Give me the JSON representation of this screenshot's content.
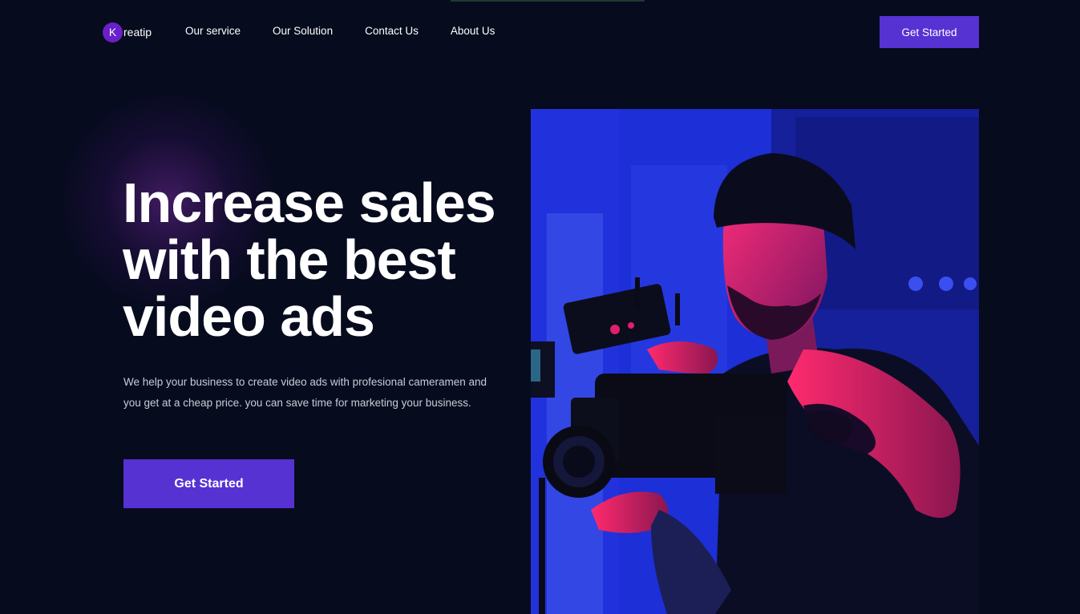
{
  "brand": {
    "mark": "K",
    "name": "reatip"
  },
  "nav": {
    "links": [
      "Our service",
      "Our Solution",
      "Contact Us",
      "About Us"
    ],
    "cta_label": "Get Started"
  },
  "hero": {
    "title_lines": [
      "Increase sales",
      "with the best",
      "video ads"
    ],
    "description": "We help your business to create video ads with profesional cameramen and you get at a cheap price. you can save time for marketing your business.",
    "cta_label": "Get Started"
  },
  "colors": {
    "background": "#060b1e",
    "accent": "#5632d3",
    "logo_mark": "#6a1fc8"
  },
  "icons": {
    "logo": "brand-logo-icon"
  }
}
